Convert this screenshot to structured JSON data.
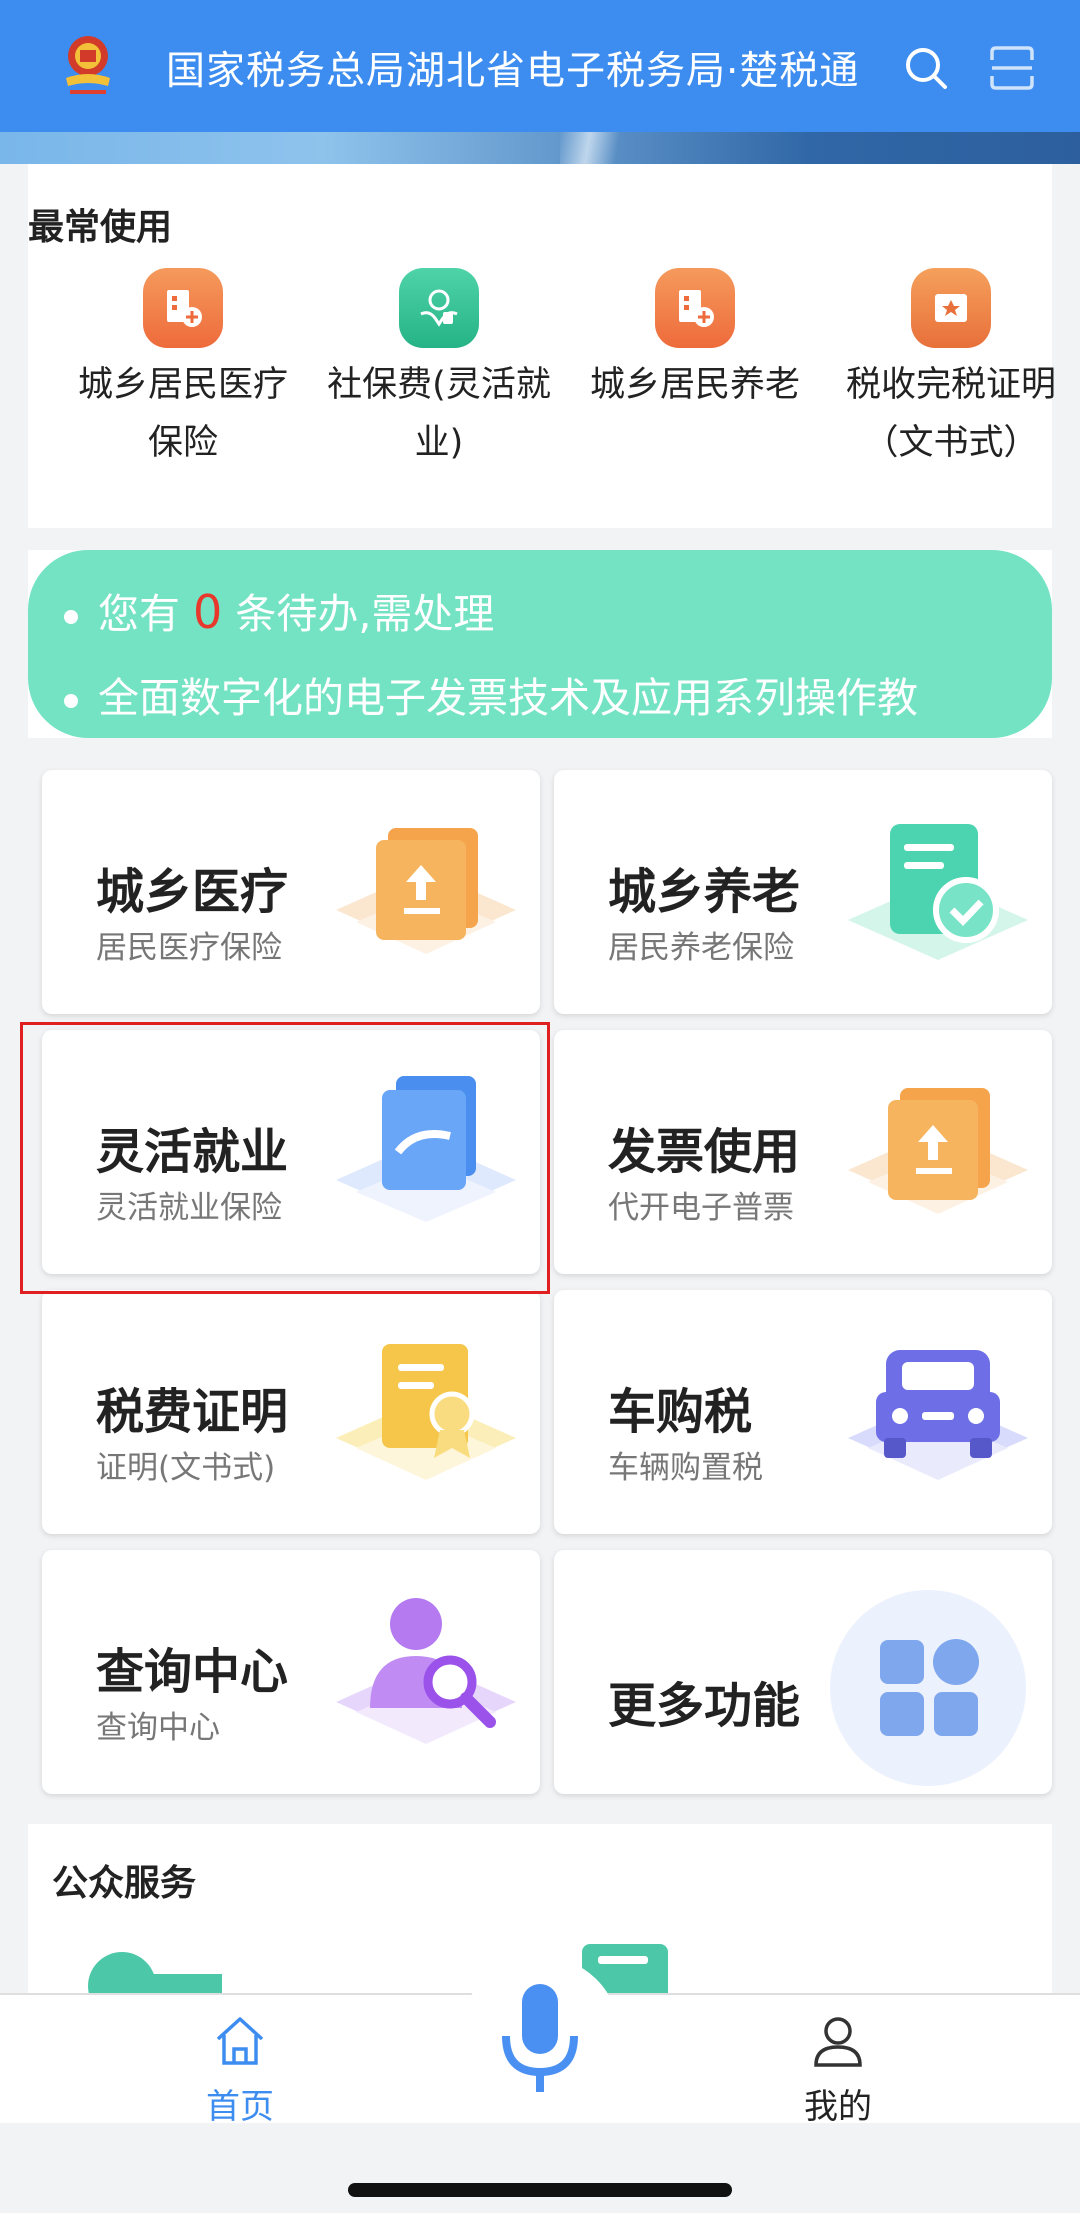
{
  "header": {
    "title": "国家税务总局湖北省电子税务局·楚税通",
    "search_icon": "search-icon",
    "scan_icon": "scan-icon",
    "brand_color": "#3d8df0"
  },
  "frequent": {
    "title": "最常使用",
    "items": [
      {
        "label": "城乡居民医疗保险",
        "icon": "medical-insurance-icon"
      },
      {
        "label": "社保费(灵活就业)",
        "icon": "social-security-icon"
      },
      {
        "label": "城乡居民养老",
        "icon": "pension-icon"
      },
      {
        "label": "税收完税证明（文书式）",
        "icon": "tax-certificate-icon"
      }
    ]
  },
  "notice": {
    "prefix": "您有",
    "count": "0",
    "suffix": "条待办,需处理",
    "second": "全面数字化的电子发票技术及应用系列操作教"
  },
  "tiles": [
    {
      "title": "城乡医疗",
      "subtitle": "居民医疗保险"
    },
    {
      "title": "城乡养老",
      "subtitle": "居民养老保险"
    },
    {
      "title": "灵活就业",
      "subtitle": "灵活就业保险"
    },
    {
      "title": "发票使用",
      "subtitle": "代开电子普票"
    },
    {
      "title": "税费证明",
      "subtitle": "证明(文书式)"
    },
    {
      "title": "车购税",
      "subtitle": "车辆购置税"
    },
    {
      "title": "查询中心",
      "subtitle": "查询中心"
    },
    {
      "title": "更多功能",
      "subtitle": ""
    }
  ],
  "public": {
    "title": "公众服务"
  },
  "nav": {
    "home": "首页",
    "mine": "我的",
    "active_color": "#3d8df0"
  }
}
